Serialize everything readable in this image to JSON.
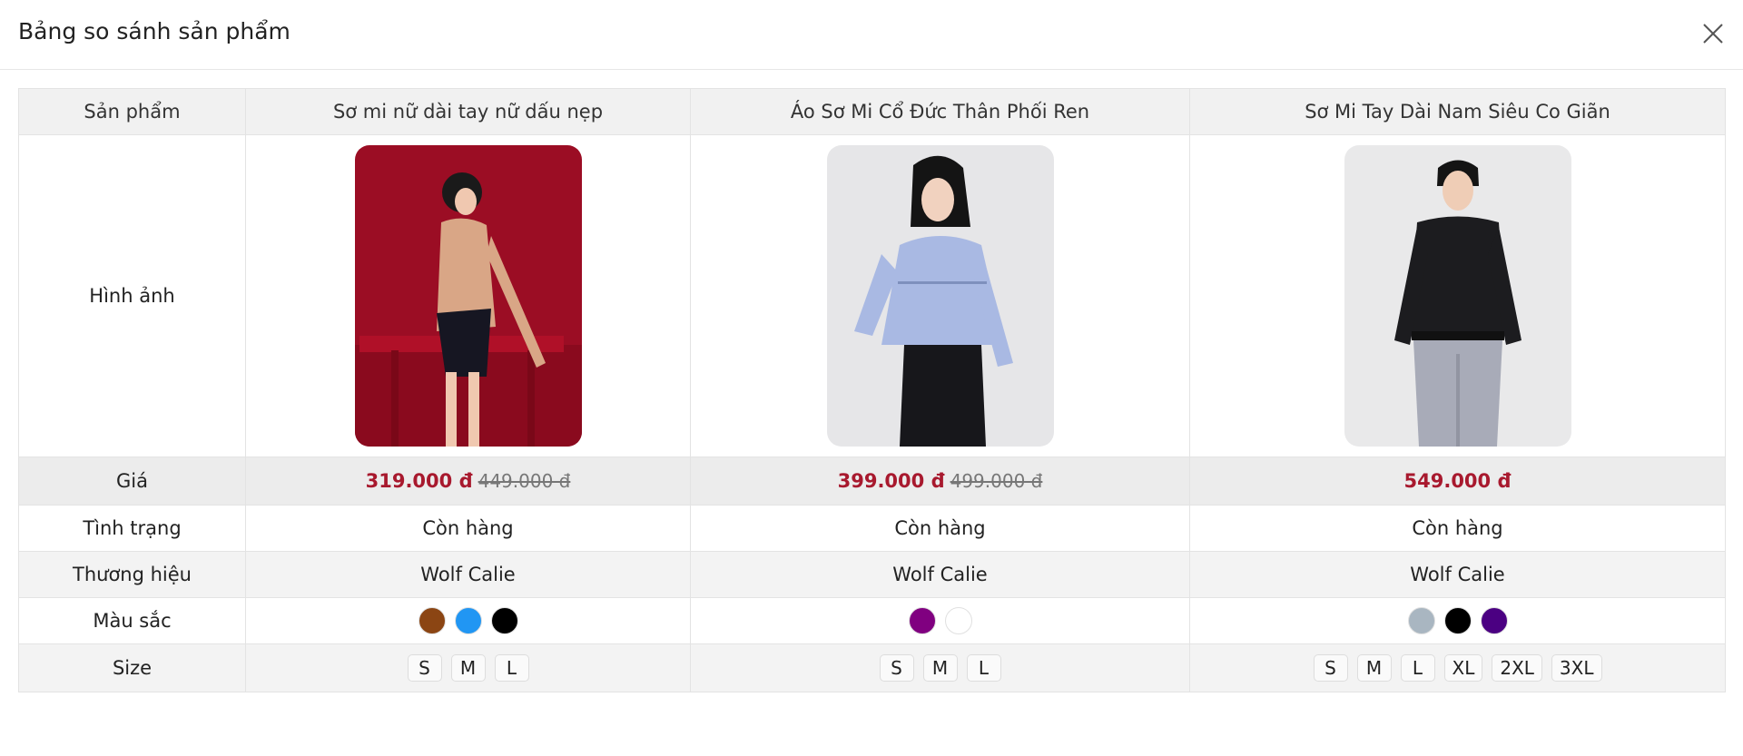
{
  "dialog": {
    "title": "Bảng so sánh sản phẩm",
    "close_icon": "close-icon"
  },
  "table": {
    "labels": {
      "product": "Sản phẩm",
      "image": "Hình ảnh",
      "price": "Giá",
      "status": "Tình trạng",
      "brand": "Thương hiệu",
      "colors": "Màu sắc",
      "size": "Size"
    },
    "products": [
      {
        "name": "Sơ mi nữ dài tay nữ dấu nẹp",
        "price": "319.000 đ",
        "old_price": "449.000 đ",
        "status": "Còn hàng",
        "brand": "Wolf Calie",
        "colors": [
          "#8B4513",
          "#2196F3",
          "#000000"
        ],
        "sizes": [
          "S",
          "M",
          "L"
        ]
      },
      {
        "name": "Áo Sơ Mi Cổ Đức Thân Phối Ren",
        "price": "399.000 đ",
        "old_price": "499.000 đ",
        "status": "Còn hàng",
        "brand": "Wolf Calie",
        "colors": [
          "#800080",
          "#FFFFFF"
        ],
        "sizes": [
          "S",
          "M",
          "L"
        ]
      },
      {
        "name": "Sơ Mi Tay Dài Nam Siêu Co Giãn",
        "price": "549.000 đ",
        "old_price": "",
        "status": "Còn hàng",
        "brand": "Wolf Calie",
        "colors": [
          "#A9B6C1",
          "#000000",
          "#4B0082"
        ],
        "sizes": [
          "S",
          "M",
          "L",
          "XL",
          "2XL",
          "3XL"
        ]
      }
    ]
  },
  "theme": {
    "price_color": "#a8192e",
    "header_bg": "#f1f1f1"
  }
}
